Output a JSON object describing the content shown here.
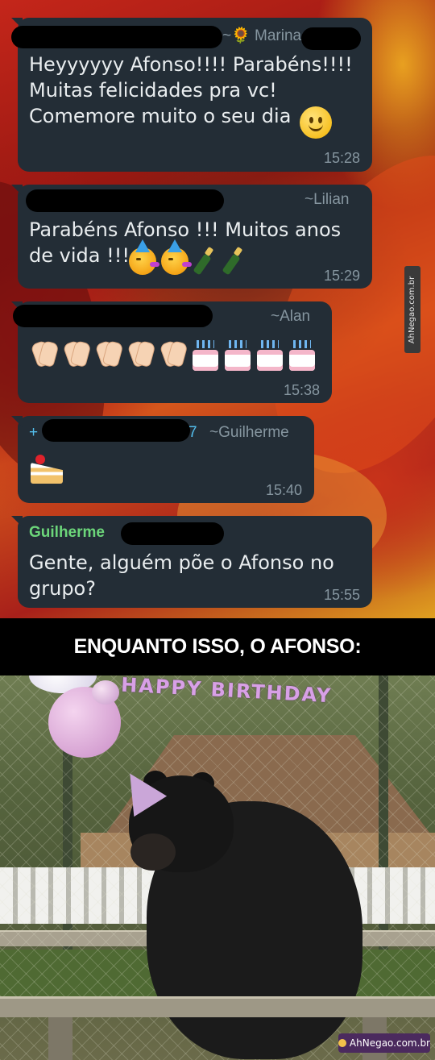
{
  "messages": [
    {
      "name": "~🌻 Marina",
      "text": "Heyyyyyy Afonso!!!! Parabéns!!!!\nMuitas felicidades pra vc!\nComemore muito o seu dia",
      "time": "15:28"
    },
    {
      "name": "~Lilian",
      "text": "Parabéns Afonso !!! Muitos anos\nde vida !!!",
      "time": "15:29",
      "emojis": [
        "partying-face-icon",
        "partying-face-icon",
        "champagne-bottle-icon",
        "champagne-bottle-icon"
      ]
    },
    {
      "name": "~Alan",
      "time": "15:38",
      "emojis": [
        "clapping-hands-icon",
        "clapping-hands-icon",
        "clapping-hands-icon",
        "clapping-hands-icon",
        "clapping-hands-icon",
        "birthday-cake-icon",
        "birthday-cake-icon",
        "birthday-cake-icon",
        "birthday-cake-icon"
      ]
    },
    {
      "name_prefix": "+",
      "name_suffix": "7",
      "name": "~Guilherme",
      "time": "15:40",
      "emojis": [
        "shortcake-icon"
      ]
    },
    {
      "name": "Guilherme",
      "text": "Gente, alguém põe o Afonso no\ngrupo?",
      "time": "15:55"
    }
  ],
  "caption": "ENQUANTO ISSO, O AFONSO:",
  "banner_text": "HAPPY BIRTHDAY",
  "watermark": "AhNegao.com.br",
  "colors": {
    "bubble": "#232d36",
    "time_text": "#8696a0",
    "author_green": "#6cd67a",
    "author_teal": "#53bdeb",
    "caption_bg": "#000000",
    "watermark_bg": "#4b2a5e"
  }
}
